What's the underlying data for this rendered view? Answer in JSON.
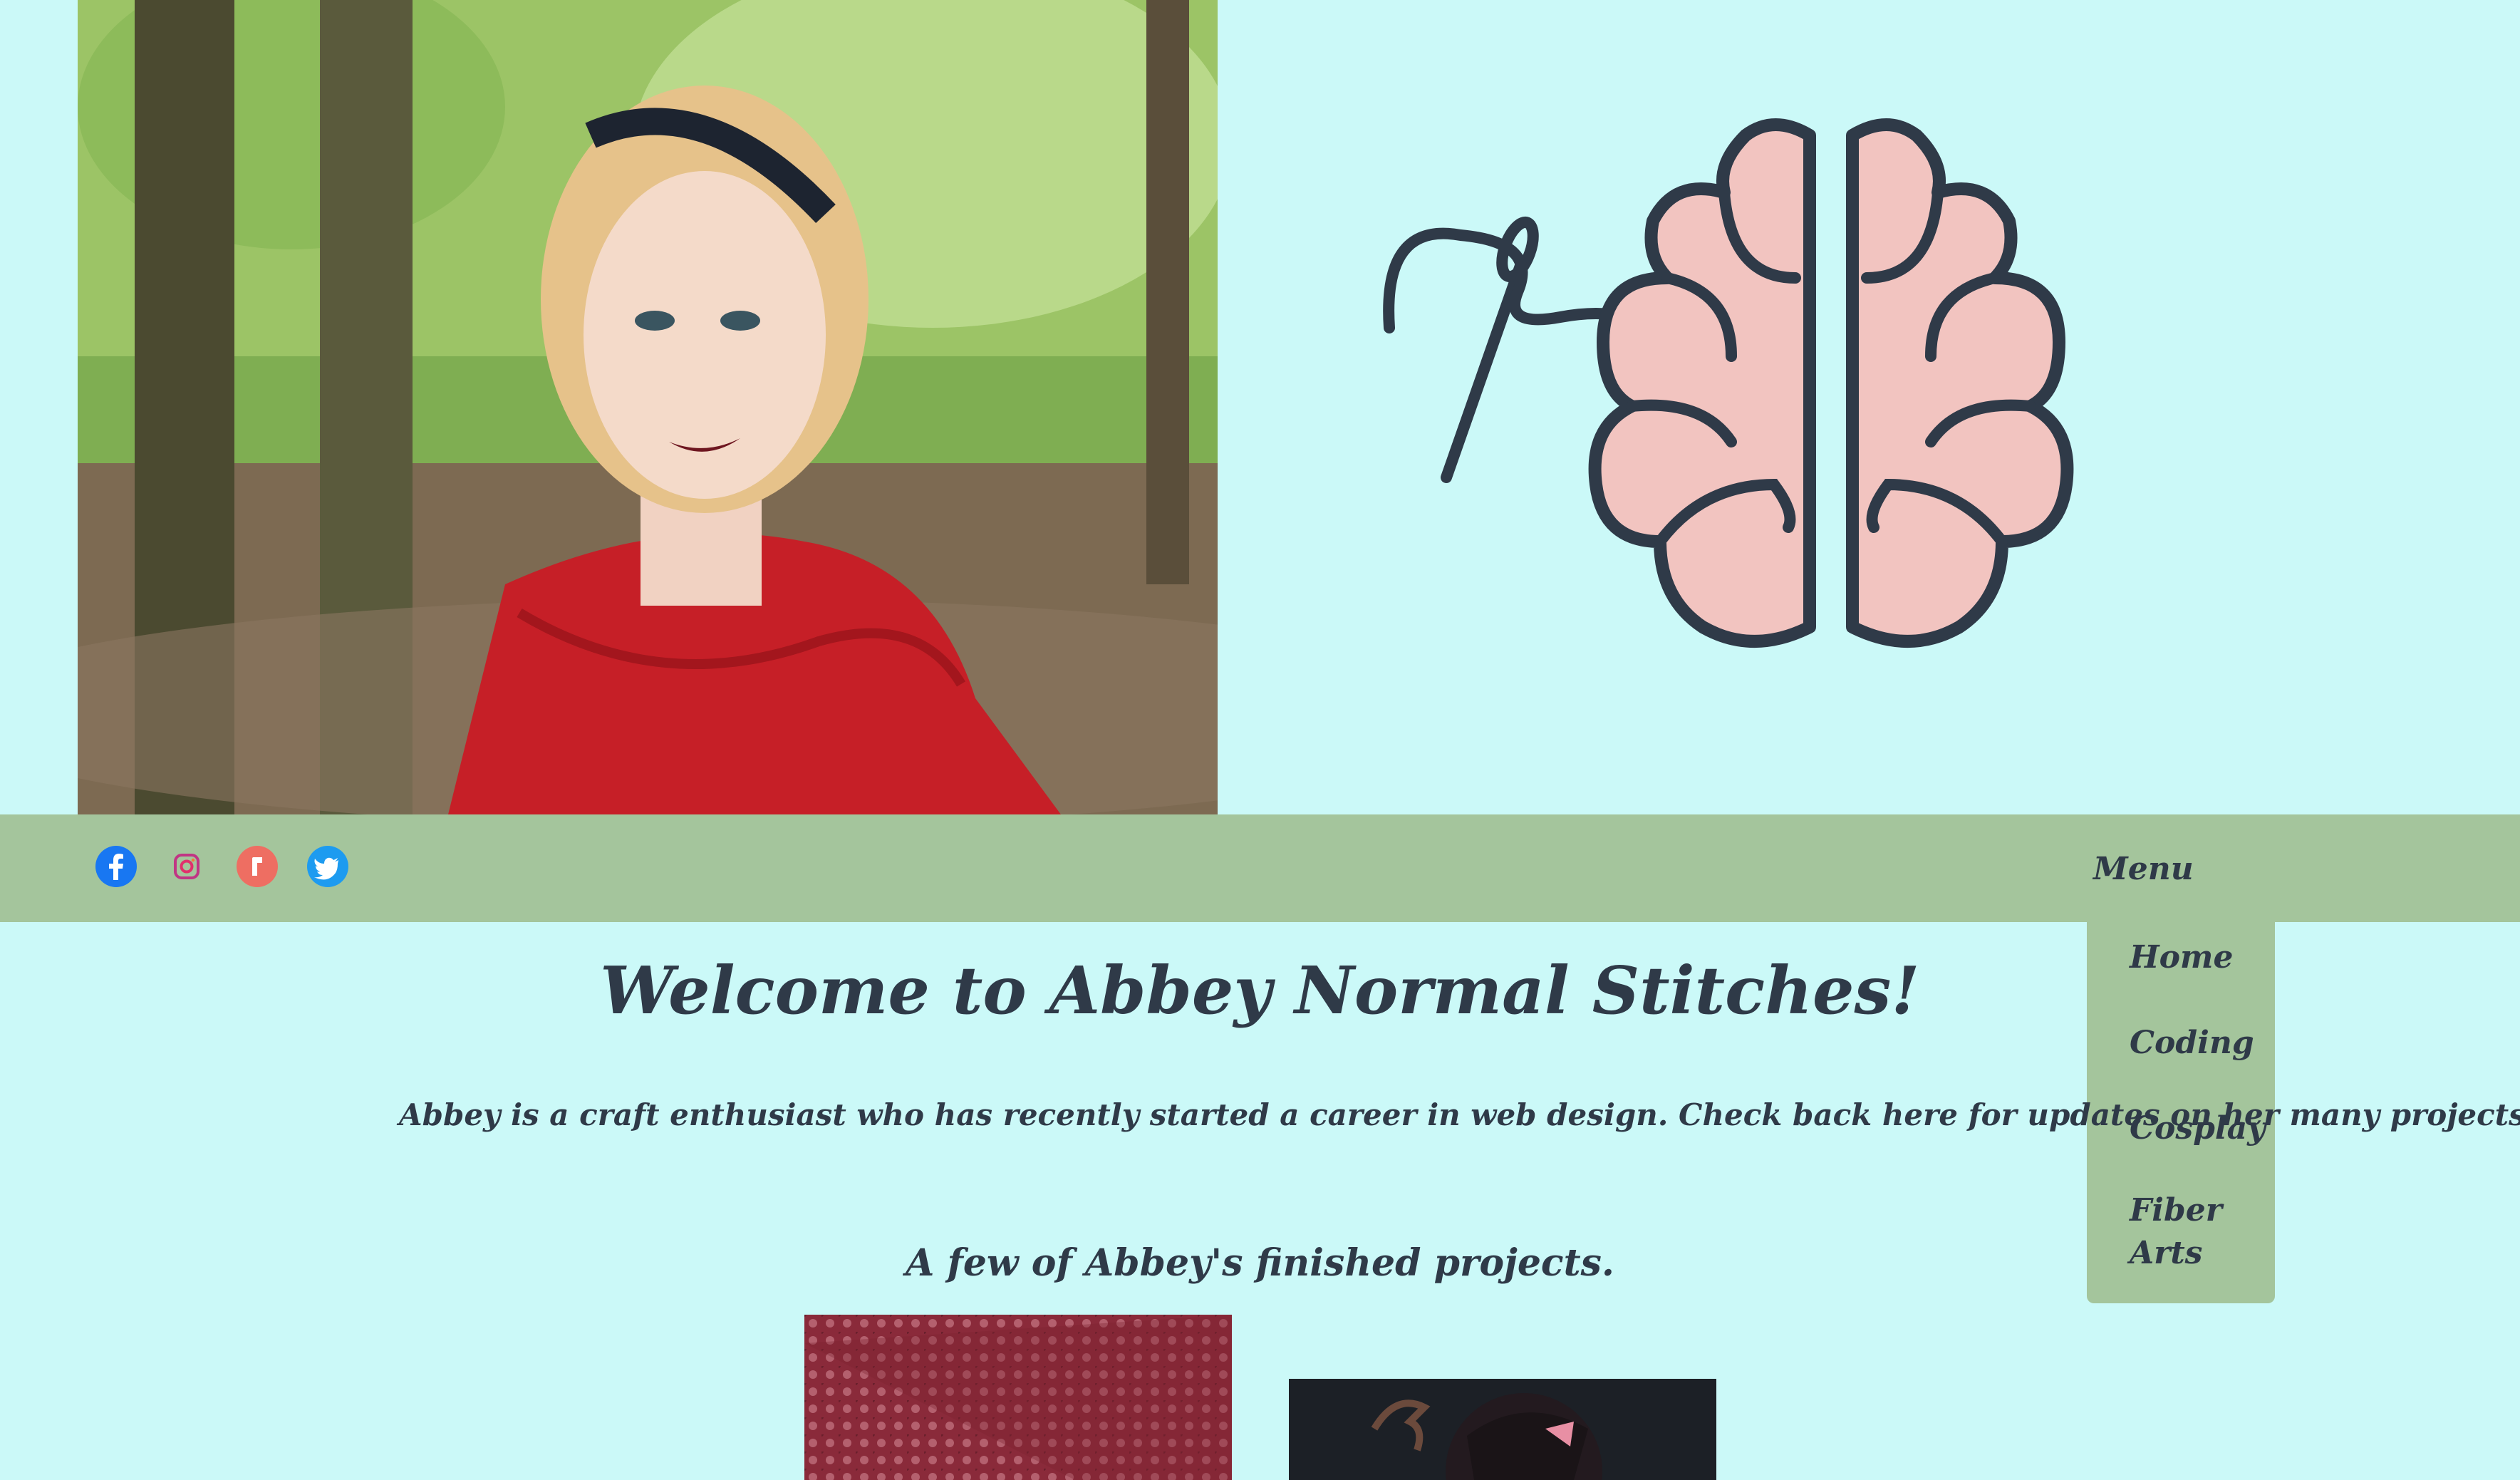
{
  "header": {
    "photo_alt": "Abbey portrait",
    "logo_alt": "Abbey Normal Stitches logo"
  },
  "social": [
    {
      "name": "facebook-icon",
      "color": "#1877f2"
    },
    {
      "name": "instagram-icon",
      "color": "#e1306c"
    },
    {
      "name": "ravelry-icon",
      "color": "#ee6e62"
    },
    {
      "name": "twitter-icon",
      "color": "#1d9bf0"
    }
  ],
  "nav": {
    "menu_label": "Menu",
    "items": [
      "Home",
      "Coding",
      "Cosplay",
      "Fiber Arts"
    ]
  },
  "main": {
    "title": "Welcome to Abbey Normal Stitches!",
    "intro": "Abbey is a craft enthusiast who has recently started a career in web design. Check back here for updates on her many projects!",
    "projects_heading": "A few of Abbey's finished projects."
  },
  "colors": {
    "background": "#cbf9f8",
    "navbar": "#a4c59c",
    "text": "#2f3a48",
    "brain": "#f2c4c0"
  }
}
